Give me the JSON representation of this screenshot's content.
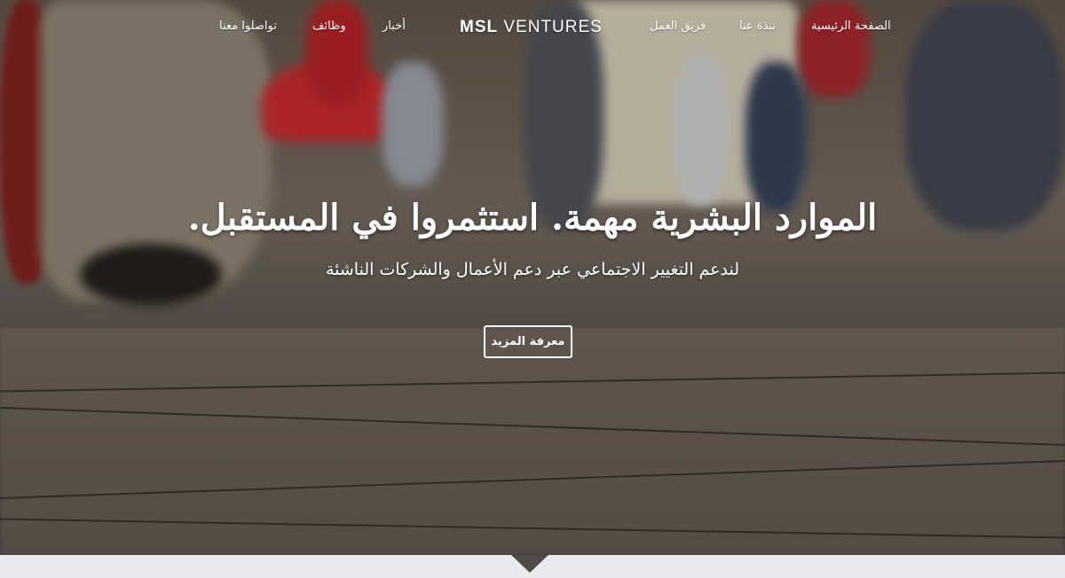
{
  "nav": {
    "home": "الصفحة الرئيسية",
    "about": "نبذة عنا",
    "team": "فريق العمل",
    "brand_bold": "MSL",
    "brand_rest": " VENTURES",
    "news": "أخبار",
    "jobs": "وظائف",
    "contact": "تواصلوا معنا"
  },
  "hero": {
    "headline": "الموارد البشرية مهمة. استثمروا في المستقبل.",
    "subline": "لندعم التغيير الاجتماعي عبر دعم الأعمال والشركات الناشئة",
    "cta": "معرفة المزيد"
  },
  "icons": {
    "scroll_pointer": "triangle-down-icon"
  }
}
